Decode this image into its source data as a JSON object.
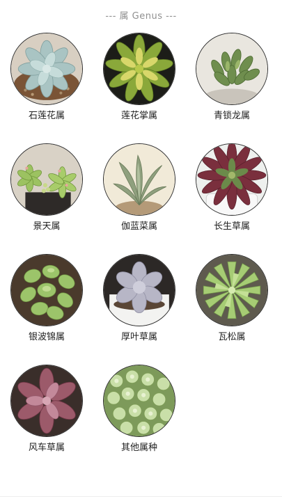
{
  "header": {
    "title": "--- 属 Genus ---"
  },
  "genera": [
    {
      "name": "石莲花属",
      "icon": "echeveria-image"
    },
    {
      "name": "莲花掌属",
      "icon": "aeonium-image"
    },
    {
      "name": "青锁龙属",
      "icon": "crassula-image"
    },
    {
      "name": "景天属",
      "icon": "sedum-image"
    },
    {
      "name": "伽蓝菜属",
      "icon": "kalanchoe-image"
    },
    {
      "name": "长生草属",
      "icon": "sempervivum-image"
    },
    {
      "name": "银波锦属",
      "icon": "cotyledon-image"
    },
    {
      "name": "厚叶草属",
      "icon": "pachyphytum-image"
    },
    {
      "name": "瓦松属",
      "icon": "orostachys-image"
    },
    {
      "name": "风车草属",
      "icon": "graptopetalum-image"
    },
    {
      "name": "其他属种",
      "icon": "other-genera-image"
    }
  ],
  "colors": {
    "header_text": "#8f8f8f",
    "label_text": "#222222",
    "circle_border": "#2c2c2c"
  }
}
